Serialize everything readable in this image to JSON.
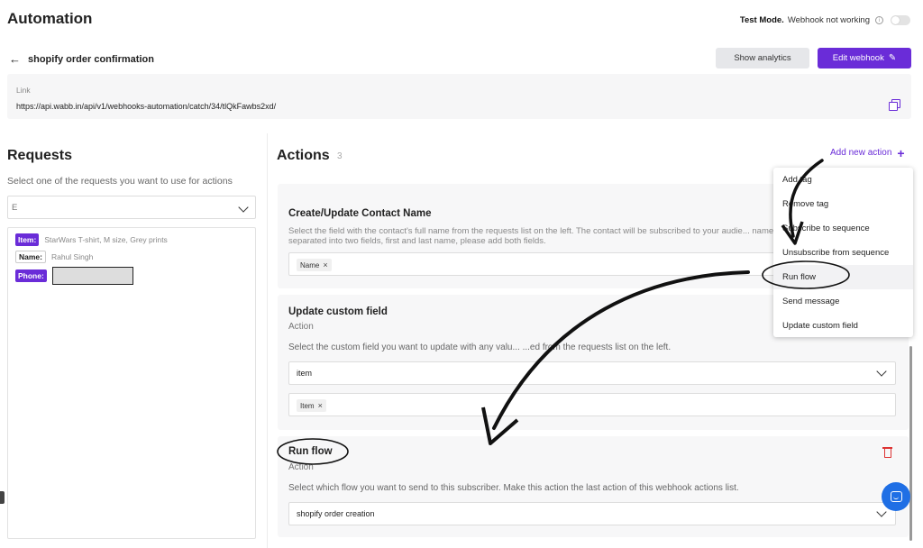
{
  "header": {
    "title": "Automation",
    "test_mode_label": "Test Mode.",
    "test_mode_status": "Webhook not working",
    "info_glyph": "i"
  },
  "page": {
    "back_glyph": "←",
    "webhook_name": "shopify order confirmation",
    "show_analytics": "Show analytics",
    "edit_webhook": "Edit webhook",
    "edit_glyph": "✎"
  },
  "link": {
    "label": "Link",
    "url": "https://api.wabb.in/api/v1/webhooks-automation/catch/34/tlQkFawbs2xd/"
  },
  "requests": {
    "title": "Requests",
    "subtitle": "Select one of the requests you want to use for actions",
    "selected": "E",
    "rows": [
      {
        "key": "Item:",
        "value": "StarWars T-shirt, M size, Grey prints"
      },
      {
        "key": "Name:",
        "value": "Rahul Singh"
      },
      {
        "key": "Phone:",
        "value": ""
      }
    ]
  },
  "actions": {
    "title": "Actions",
    "count": "3",
    "add_new": "Add new action",
    "add_glyph": "+",
    "cards": [
      {
        "title": "Create/Update Contact Name",
        "desc": "Select the field with the contact's full name from the requests list on the left. The contact will be subscribed to your audie... name is separated into two fields, first and last name, please add both fields.",
        "chip": "Name"
      },
      {
        "title": "Update custom field",
        "sub": "Action",
        "desc": "Select the custom field you want to update with any valu... ...ed from the requests list on the left.",
        "select_value": "item",
        "chip": "Item"
      },
      {
        "title": "Run flow",
        "sub": "Action",
        "desc": "Select which flow you want to send to this subscriber. Make this action the last action of this webhook actions list.",
        "select_value": "shopify order creation"
      }
    ],
    "chip_remove_glyph": "×"
  },
  "menu": {
    "items": [
      "Add tag",
      "Remove tag",
      "Subscribe to sequence",
      "Unsubscribe from sequence",
      "Run flow",
      "Send message",
      "Update custom field"
    ],
    "highlighted": "Run flow"
  },
  "colors": {
    "accent": "#6a2cd8",
    "danger": "#d33333",
    "chat": "#1f6fe5"
  }
}
